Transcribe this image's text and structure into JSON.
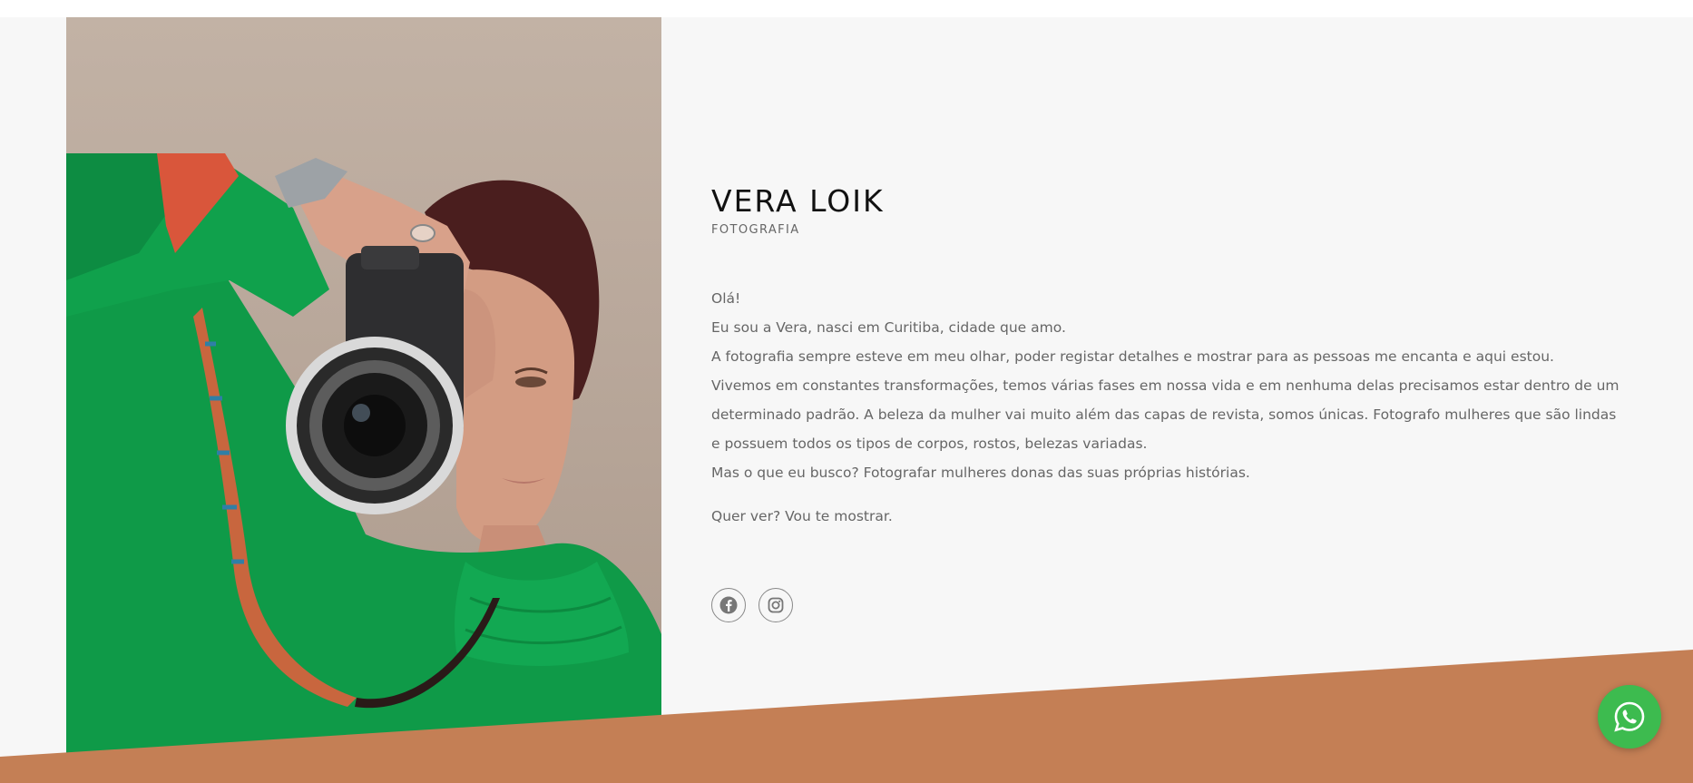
{
  "profile": {
    "name": "VERA LOIK",
    "tagline": "FOTOGRAFIA"
  },
  "bio": {
    "greeting": "Olá!",
    "paragraphs": [
      "Eu sou a Vera, nasci em Curitiba, cidade que amo.",
      "A fotografia sempre esteve em meu olhar, poder registar detalhes e mostrar para as pessoas me encanta e aqui estou.",
      "Vivemos em constantes transformações, temos várias fases em nossa vida e em nenhuma delas precisamos estar dentro de um determinado padrão. A beleza da mulher vai muito além das capas de revista, somos únicas. Fotografo mulheres que são lindas e possuem todos os tipos de corpos, rostos, belezas variadas.",
      "Mas o que eu busco? Fotografar mulheres donas das suas próprias histórias."
    ],
    "cta": "Quer ver? Vou te mostrar."
  },
  "social": {
    "items": [
      {
        "icon": "facebook-icon"
      },
      {
        "icon": "instagram-icon"
      }
    ]
  },
  "whatsapp": {
    "icon": "whatsapp-icon"
  },
  "colors": {
    "background": "#f7f7f7",
    "accent": "#c47f55",
    "whatsapp": "#3dbb4f",
    "heading": "#111111",
    "body_text": "#666666"
  }
}
